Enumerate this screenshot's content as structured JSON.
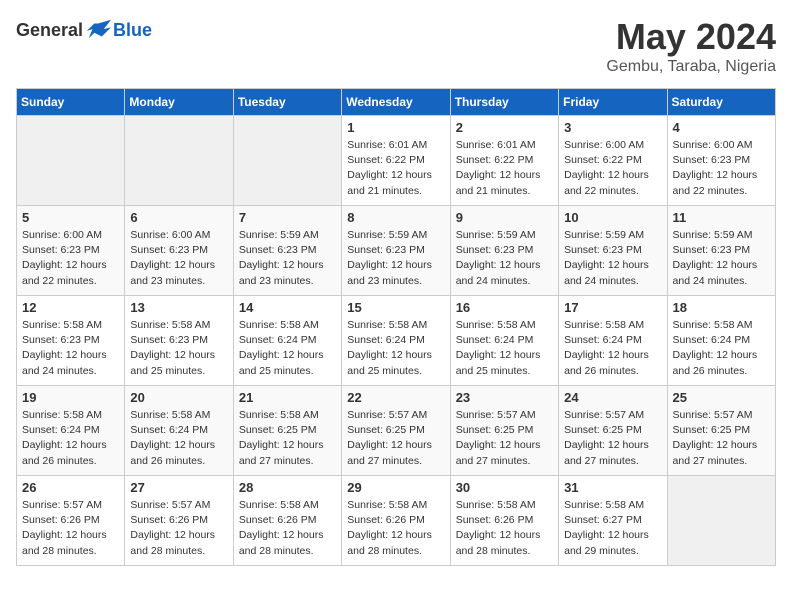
{
  "header": {
    "logo_general": "General",
    "logo_blue": "Blue",
    "title": "May 2024",
    "subtitle": "Gembu, Taraba, Nigeria"
  },
  "calendar": {
    "days_of_week": [
      "Sunday",
      "Monday",
      "Tuesday",
      "Wednesday",
      "Thursday",
      "Friday",
      "Saturday"
    ],
    "weeks": [
      [
        {
          "day": "",
          "info": ""
        },
        {
          "day": "",
          "info": ""
        },
        {
          "day": "",
          "info": ""
        },
        {
          "day": "1",
          "info": "Sunrise: 6:01 AM\nSunset: 6:22 PM\nDaylight: 12 hours\nand 21 minutes."
        },
        {
          "day": "2",
          "info": "Sunrise: 6:01 AM\nSunset: 6:22 PM\nDaylight: 12 hours\nand 21 minutes."
        },
        {
          "day": "3",
          "info": "Sunrise: 6:00 AM\nSunset: 6:22 PM\nDaylight: 12 hours\nand 22 minutes."
        },
        {
          "day": "4",
          "info": "Sunrise: 6:00 AM\nSunset: 6:23 PM\nDaylight: 12 hours\nand 22 minutes."
        }
      ],
      [
        {
          "day": "5",
          "info": "Sunrise: 6:00 AM\nSunset: 6:23 PM\nDaylight: 12 hours\nand 22 minutes."
        },
        {
          "day": "6",
          "info": "Sunrise: 6:00 AM\nSunset: 6:23 PM\nDaylight: 12 hours\nand 23 minutes."
        },
        {
          "day": "7",
          "info": "Sunrise: 5:59 AM\nSunset: 6:23 PM\nDaylight: 12 hours\nand 23 minutes."
        },
        {
          "day": "8",
          "info": "Sunrise: 5:59 AM\nSunset: 6:23 PM\nDaylight: 12 hours\nand 23 minutes."
        },
        {
          "day": "9",
          "info": "Sunrise: 5:59 AM\nSunset: 6:23 PM\nDaylight: 12 hours\nand 24 minutes."
        },
        {
          "day": "10",
          "info": "Sunrise: 5:59 AM\nSunset: 6:23 PM\nDaylight: 12 hours\nand 24 minutes."
        },
        {
          "day": "11",
          "info": "Sunrise: 5:59 AM\nSunset: 6:23 PM\nDaylight: 12 hours\nand 24 minutes."
        }
      ],
      [
        {
          "day": "12",
          "info": "Sunrise: 5:58 AM\nSunset: 6:23 PM\nDaylight: 12 hours\nand 24 minutes."
        },
        {
          "day": "13",
          "info": "Sunrise: 5:58 AM\nSunset: 6:23 PM\nDaylight: 12 hours\nand 25 minutes."
        },
        {
          "day": "14",
          "info": "Sunrise: 5:58 AM\nSunset: 6:24 PM\nDaylight: 12 hours\nand 25 minutes."
        },
        {
          "day": "15",
          "info": "Sunrise: 5:58 AM\nSunset: 6:24 PM\nDaylight: 12 hours\nand 25 minutes."
        },
        {
          "day": "16",
          "info": "Sunrise: 5:58 AM\nSunset: 6:24 PM\nDaylight: 12 hours\nand 25 minutes."
        },
        {
          "day": "17",
          "info": "Sunrise: 5:58 AM\nSunset: 6:24 PM\nDaylight: 12 hours\nand 26 minutes."
        },
        {
          "day": "18",
          "info": "Sunrise: 5:58 AM\nSunset: 6:24 PM\nDaylight: 12 hours\nand 26 minutes."
        }
      ],
      [
        {
          "day": "19",
          "info": "Sunrise: 5:58 AM\nSunset: 6:24 PM\nDaylight: 12 hours\nand 26 minutes."
        },
        {
          "day": "20",
          "info": "Sunrise: 5:58 AM\nSunset: 6:24 PM\nDaylight: 12 hours\nand 26 minutes."
        },
        {
          "day": "21",
          "info": "Sunrise: 5:58 AM\nSunset: 6:25 PM\nDaylight: 12 hours\nand 27 minutes."
        },
        {
          "day": "22",
          "info": "Sunrise: 5:57 AM\nSunset: 6:25 PM\nDaylight: 12 hours\nand 27 minutes."
        },
        {
          "day": "23",
          "info": "Sunrise: 5:57 AM\nSunset: 6:25 PM\nDaylight: 12 hours\nand 27 minutes."
        },
        {
          "day": "24",
          "info": "Sunrise: 5:57 AM\nSunset: 6:25 PM\nDaylight: 12 hours\nand 27 minutes."
        },
        {
          "day": "25",
          "info": "Sunrise: 5:57 AM\nSunset: 6:25 PM\nDaylight: 12 hours\nand 27 minutes."
        }
      ],
      [
        {
          "day": "26",
          "info": "Sunrise: 5:57 AM\nSunset: 6:26 PM\nDaylight: 12 hours\nand 28 minutes."
        },
        {
          "day": "27",
          "info": "Sunrise: 5:57 AM\nSunset: 6:26 PM\nDaylight: 12 hours\nand 28 minutes."
        },
        {
          "day": "28",
          "info": "Sunrise: 5:58 AM\nSunset: 6:26 PM\nDaylight: 12 hours\nand 28 minutes."
        },
        {
          "day": "29",
          "info": "Sunrise: 5:58 AM\nSunset: 6:26 PM\nDaylight: 12 hours\nand 28 minutes."
        },
        {
          "day": "30",
          "info": "Sunrise: 5:58 AM\nSunset: 6:26 PM\nDaylight: 12 hours\nand 28 minutes."
        },
        {
          "day": "31",
          "info": "Sunrise: 5:58 AM\nSunset: 6:27 PM\nDaylight: 12 hours\nand 29 minutes."
        },
        {
          "day": "",
          "info": ""
        }
      ]
    ]
  }
}
